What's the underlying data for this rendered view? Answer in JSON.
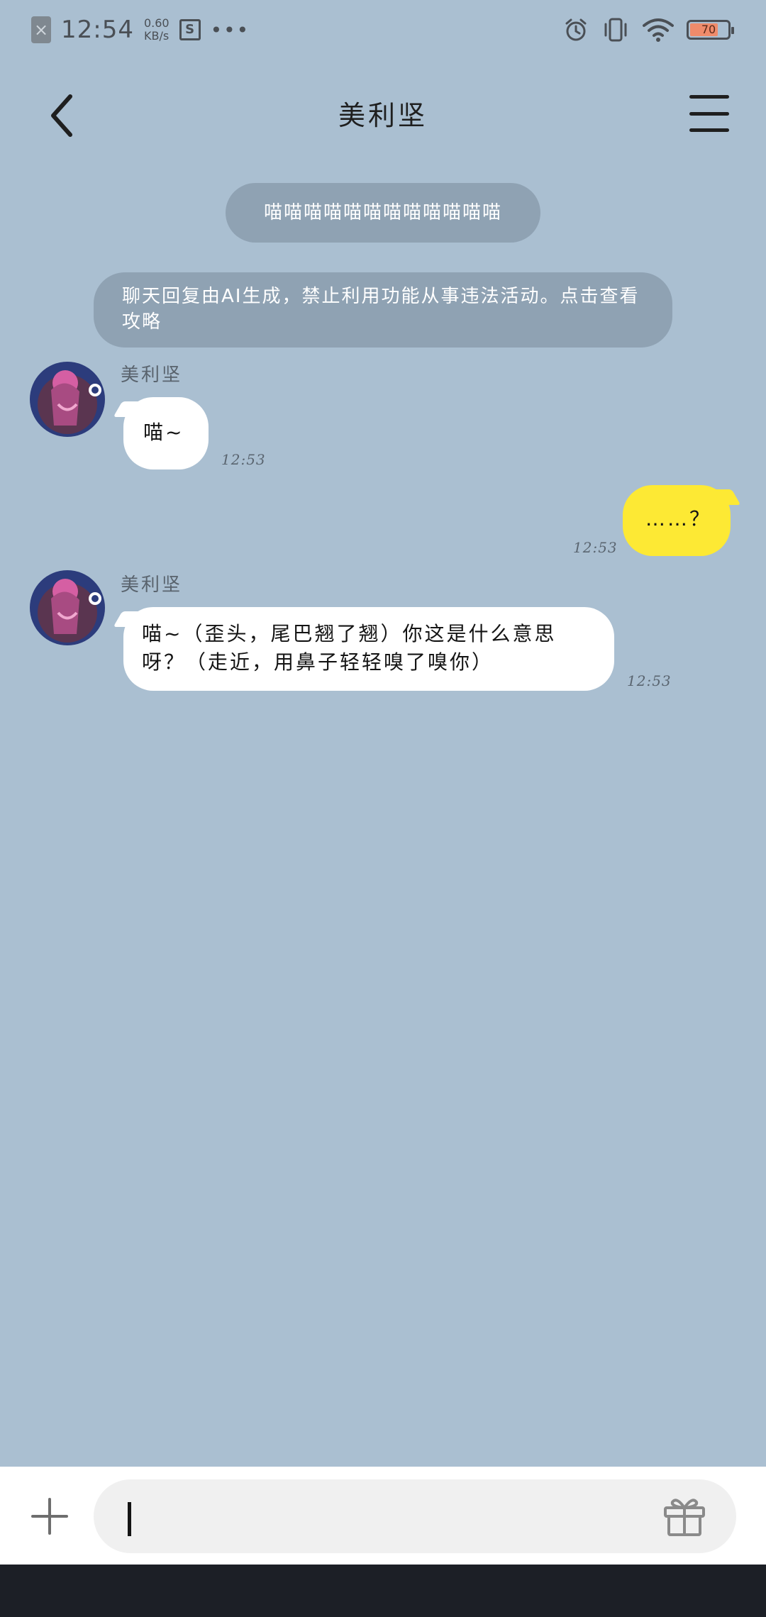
{
  "status_bar": {
    "time": "12:54",
    "net_speed_value": "0.60",
    "net_speed_unit": "KB/s",
    "screenshot_icon_letter": "S",
    "more": "•••",
    "battery_level": "70",
    "icons": [
      "sim-error-icon",
      "screenshot-icon",
      "alarm-icon",
      "vibrate-icon",
      "wifi-icon",
      "battery-icon"
    ]
  },
  "header": {
    "title": "美利坚"
  },
  "system": {
    "meow_banner": "喵喵喵喵喵喵喵喵喵喵喵喵",
    "notice": "聊天回复由AI生成，禁止利用功能从事违法活动。点击查看攻略"
  },
  "messages": [
    {
      "from": "other",
      "sender": "美利坚",
      "text": "喵~",
      "time": "12:53"
    },
    {
      "from": "me",
      "text": "……？",
      "time": "12:53"
    },
    {
      "from": "other",
      "sender": "美利坚",
      "text": "喵~（歪头，尾巴翘了翘）你这是什么意思呀？（走近，用鼻子轻轻嗅了嗅你）",
      "time": "12:53"
    }
  ],
  "input": {
    "value": "",
    "placeholder": ""
  },
  "colors": {
    "background": "#aabfd1",
    "my_bubble": "#fde934",
    "their_bubble": "#ffffff",
    "system_pill": "#8fa2b3",
    "battery_fill": "#ef8b6b",
    "nav_bar": "#1c1f26"
  }
}
